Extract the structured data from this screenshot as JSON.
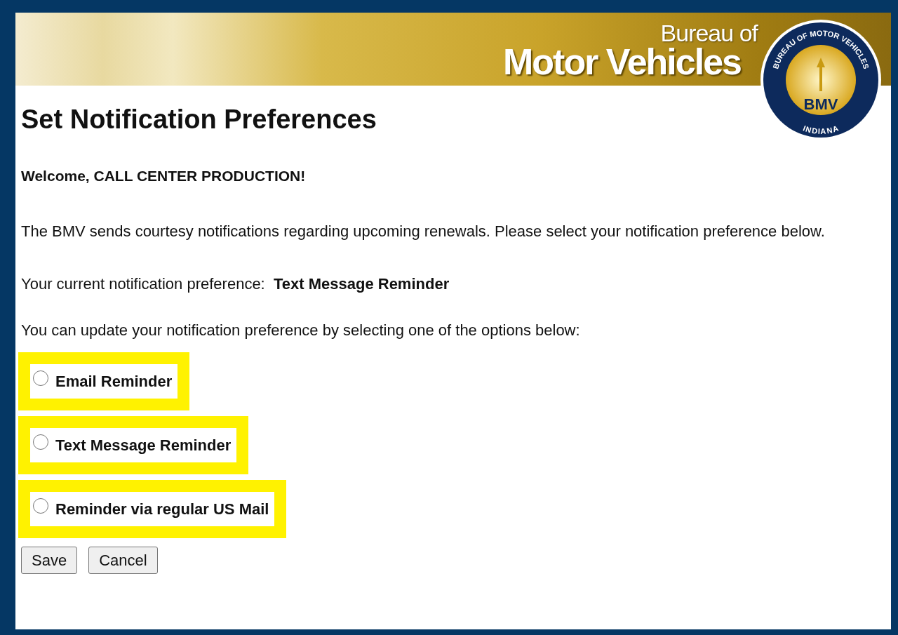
{
  "banner": {
    "line_1": "Bureau of",
    "line_2": "Motor Vehicles",
    "seal": {
      "ring_top": "BUREAU OF MOTOR VEHICLES",
      "center": "BMV",
      "ring_bottom": "INDIANA"
    }
  },
  "title": "Set Notification Preferences",
  "welcome": "Welcome, CALL CENTER PRODUCTION!",
  "intro": "The BMV sends courtesy notifications regarding upcoming renewals. Please select your notification preference below.",
  "current": {
    "label": "Your current notification preference:",
    "value": "Text Message Reminder"
  },
  "prompt": "You can update your notification preference by selecting one of the options below:",
  "options": [
    {
      "label": "Email Reminder",
      "selected": false,
      "highlighted": true
    },
    {
      "label": "Text Message Reminder",
      "selected": false,
      "highlighted": true
    },
    {
      "label": "Reminder via regular US Mail",
      "selected": false,
      "highlighted": true
    }
  ],
  "buttons": [
    "Save",
    "Cancel"
  ]
}
